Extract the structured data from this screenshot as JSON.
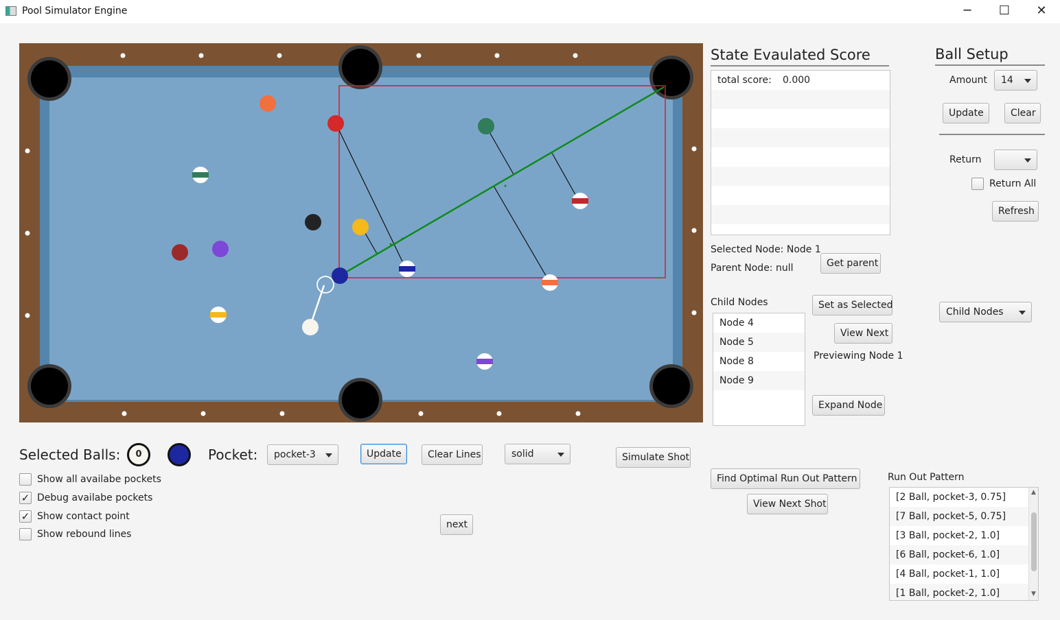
{
  "window": {
    "title": "Pool Simulator Engine",
    "minimize": "─",
    "maximize": "☐",
    "close": "✕"
  },
  "colors": {
    "felt": "#7ba5c8",
    "cushion": "#5486ad",
    "rail": "#7b5333",
    "cue": "#f6f6ef",
    "shot_line": "#0f8a1c",
    "region_box": "#d0202c"
  },
  "table": {
    "balls": [
      {
        "name": "ball-orange-solid",
        "color": "#f07040",
        "stripe": false
      },
      {
        "name": "ball-red-solid",
        "color": "#d4282b",
        "stripe": false
      },
      {
        "name": "ball-green-solid",
        "color": "#2f7d5a",
        "stripe": false
      },
      {
        "name": "ball-green-stripe",
        "color": "#2f7d5a",
        "stripe": true
      },
      {
        "name": "ball-black",
        "color": "#232323",
        "stripe": false
      },
      {
        "name": "ball-yellow-solid",
        "color": "#f5b91a",
        "stripe": false
      },
      {
        "name": "ball-maroon-solid",
        "color": "#9b2a2a",
        "stripe": false
      },
      {
        "name": "ball-purple-solid",
        "color": "#7d48d8",
        "stripe": false
      },
      {
        "name": "ball-blue-solid",
        "color": "#1c27a0",
        "stripe": false
      },
      {
        "name": "ball-blue-stripe",
        "color": "#1c27a0",
        "stripe": true
      },
      {
        "name": "ball-red-stripe",
        "color": "#c0282b",
        "stripe": true
      },
      {
        "name": "ball-orange-stripe",
        "color": "#f07040",
        "stripe": true
      },
      {
        "name": "ball-yellow-stripe",
        "color": "#f5b91a",
        "stripe": true
      },
      {
        "name": "ball-purple-stripe",
        "color": "#7d48d8",
        "stripe": true
      },
      {
        "name": "cue-ball",
        "color": "#f6f6ef",
        "stripe": false
      }
    ]
  },
  "state_score": {
    "heading": "State Evaulated Score",
    "rows": [
      {
        "label": "total score:",
        "value": "0.000"
      },
      {},
      {},
      {},
      {},
      {},
      {},
      {}
    ]
  },
  "ball_setup": {
    "heading": "Ball Setup",
    "amount_label": "Amount",
    "amount_value": "14",
    "update_label": "Update",
    "clear_label": "Clear",
    "return_label": "Return",
    "return_value": "",
    "return_all_label": "Return All",
    "refresh_label": "Refresh"
  },
  "nodes": {
    "selected": "Selected Node: Node 1",
    "parent": "Parent Node: null",
    "get_parent": "Get parent",
    "child_nodes_label": "Child Nodes",
    "children": [
      "Node 4",
      "Node 5",
      "Node 8",
      "Node 9",
      ""
    ],
    "set_selected": "Set as Selected",
    "view_next": "View Next",
    "previewing": "Previewing Node 1",
    "expand": "Expand Node",
    "child_nodes_combo": "Child Nodes"
  },
  "controls": {
    "selected_balls_label": "Selected Balls:",
    "selected_ball_1": "0",
    "selected_ball_2": "2",
    "pocket_label": "Pocket:",
    "pocket_value": "pocket-3",
    "update_label": "Update",
    "clear_lines_label": "Clear Lines",
    "type_value": "solid",
    "simulate_label": "Simulate Shot",
    "next_label": "next",
    "checkboxes": [
      {
        "label": "Show all availabe pockets",
        "checked": false
      },
      {
        "label": "Debug availabe pockets",
        "checked": true
      },
      {
        "label": "Show contact point",
        "checked": true
      },
      {
        "label": "Show rebound lines",
        "checked": false
      }
    ]
  },
  "runout": {
    "find_label": "Find Optimal Run Out Pattern",
    "view_next_label": "View Next Shot",
    "heading": "Run Out Pattern",
    "items": [
      "[2 Ball, pocket-3, 0.75]",
      "[7 Ball, pocket-5, 0.75]",
      "[3 Ball, pocket-2, 1.0]",
      "[6 Ball, pocket-6, 1.0]",
      "[4 Ball, pocket-1, 1.0]",
      "[1 Ball, pocket-2, 1.0]"
    ]
  }
}
